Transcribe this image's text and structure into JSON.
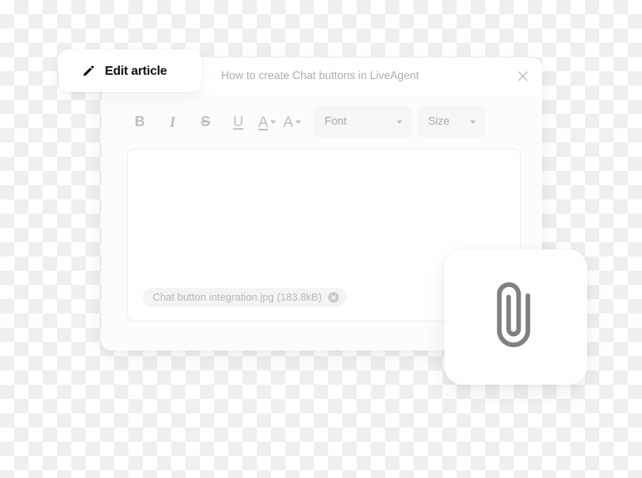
{
  "tab": {
    "label": "Edit article",
    "icon": "pencil-icon"
  },
  "panel": {
    "title": "How to create Chat buttons in LiveAgent",
    "close_icon": "close-icon"
  },
  "toolbar": {
    "buttons": [
      {
        "name": "bold",
        "glyph": "B",
        "icon": "bold-icon"
      },
      {
        "name": "italic",
        "glyph": "I",
        "icon": "italic-icon"
      },
      {
        "name": "strikethrough",
        "glyph": "S",
        "icon": "strikethrough-icon"
      },
      {
        "name": "underline",
        "glyph": "U",
        "icon": "underline-icon"
      }
    ],
    "splits": [
      {
        "name": "font-color",
        "glyph": "A",
        "icon": "font-color-icon"
      },
      {
        "name": "background-color",
        "glyph": "A",
        "icon": "background-color-icon"
      }
    ],
    "dropdowns": [
      {
        "name": "font",
        "label": "Font"
      },
      {
        "name": "size",
        "label": "Size"
      }
    ]
  },
  "editor": {
    "content": "",
    "placeholder": ""
  },
  "attachment": {
    "filename": "Chat button integration.jpg",
    "size": "(183.8kB)",
    "label": "Chat button integration.jpg (183.8kB)",
    "remove_icon": "close-circle-icon"
  },
  "floating_card": {
    "icon": "paperclip-icon"
  },
  "colors": {
    "text_muted": "#adadad",
    "text_dark": "#0d0d0d",
    "toolbar_icon": "#bcbcbc",
    "dropdown_bg": "#f6f6f6",
    "chip_bg": "#f4f4f4",
    "panel_bg": "#fcfcfc",
    "card_bg": "#ffffff",
    "paperclip": "#808080"
  }
}
